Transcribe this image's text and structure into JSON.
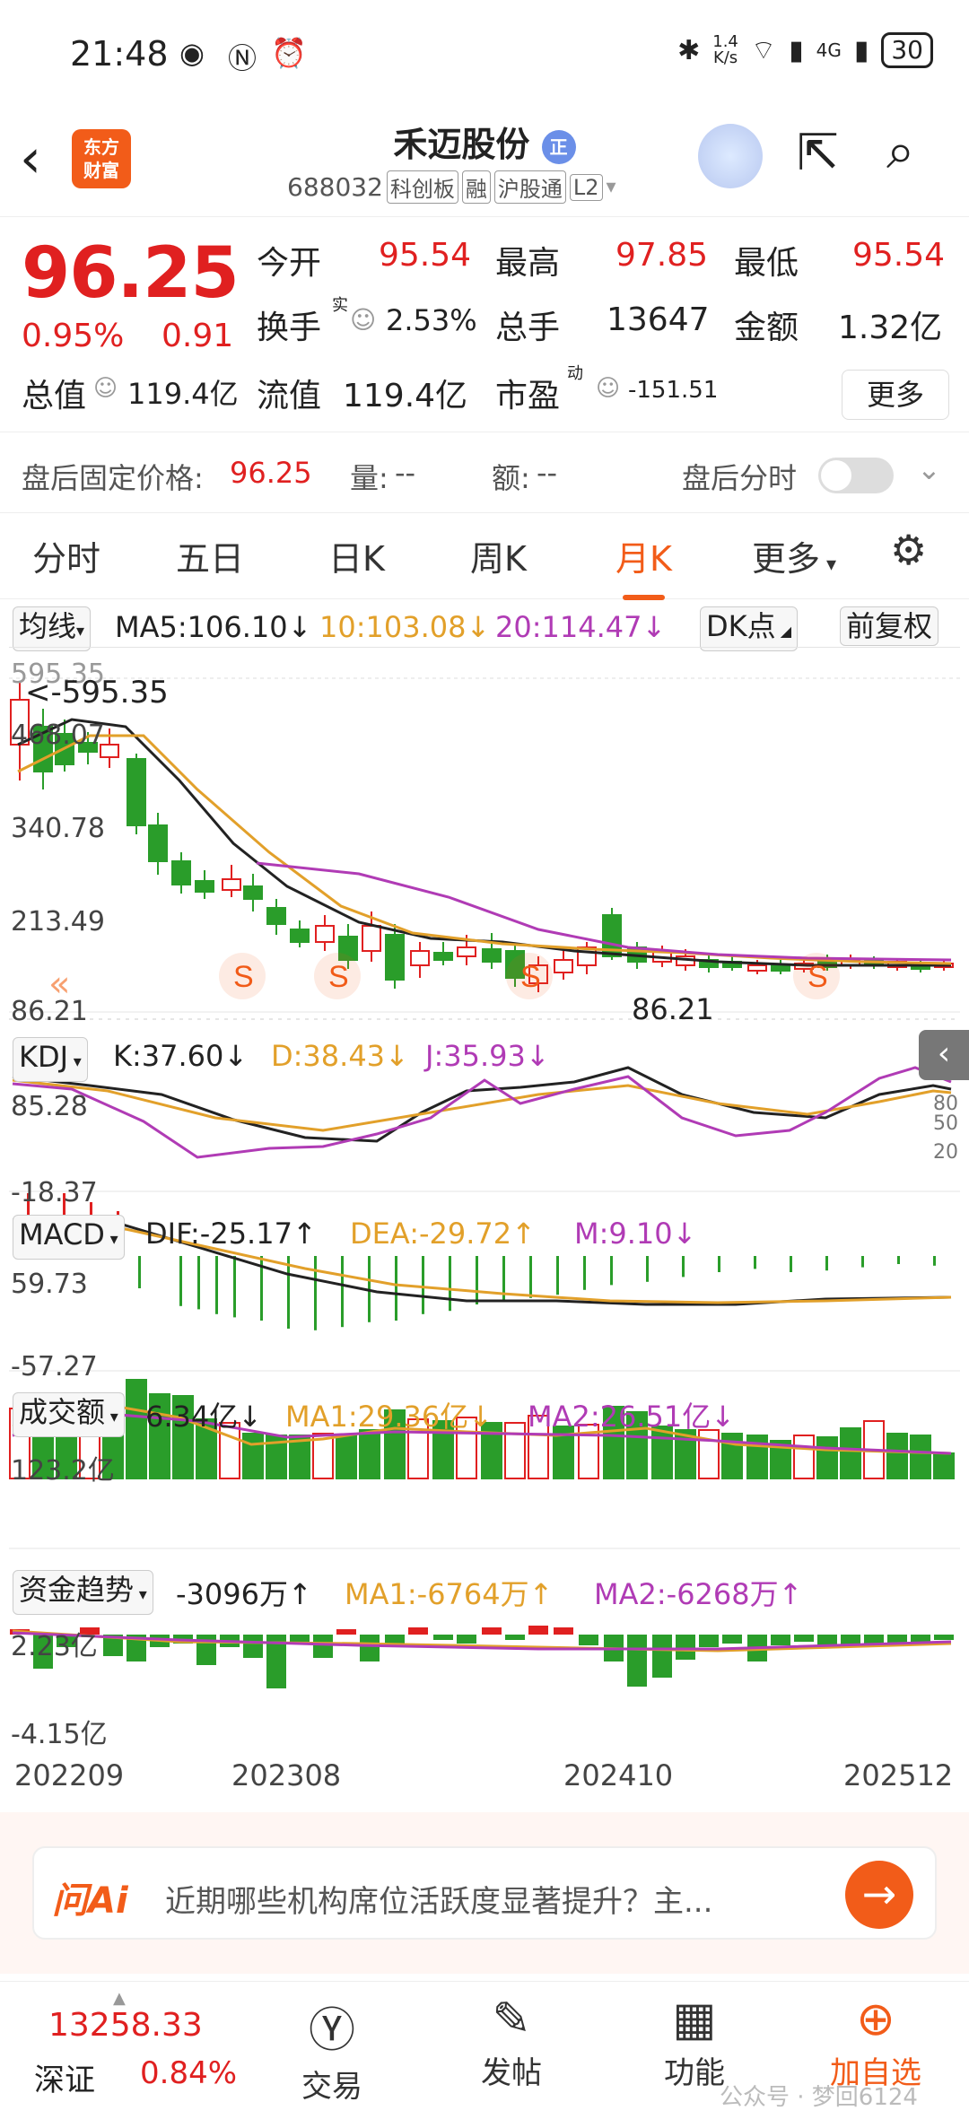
{
  "status_bar": {
    "time": "21:48",
    "net_speed": "1.4\nK/s",
    "network": "4G",
    "battery": "30"
  },
  "header": {
    "stock_name": "禾迈股份",
    "name_badge": "正",
    "logo": "东方\n财富",
    "code": "688032",
    "badges": [
      "科创板",
      "融",
      "沪股通",
      "L2"
    ]
  },
  "quote": {
    "price": "96.25",
    "change_pct": "0.95%",
    "change": "0.91",
    "open_label": "今开",
    "open": "95.54",
    "high_label": "最高",
    "high": "97.85",
    "low_label": "最低",
    "low": "95.54",
    "turnover_label": "换手",
    "turnover_sup": "实",
    "turnover": "2.53%",
    "volume_label": "总手",
    "volume": "13647",
    "amount_label": "金额",
    "amount": "1.32亿",
    "mcap_label": "总值",
    "mcap": "119.4亿",
    "float_label": "流值",
    "float": "119.4亿",
    "pe_label": "市盈",
    "pe_sup": "动",
    "pe": "-151.51",
    "more": "更多"
  },
  "after_hours": {
    "fixed_price_label": "盘后固定价格:",
    "fixed_price": "96.25",
    "volume_label": "量:",
    "volume": "--",
    "amount_label": "额:",
    "amount": "--",
    "intraday_label": "盘后分时"
  },
  "tabs": [
    "分时",
    "五日",
    "日K",
    "周K",
    "月K",
    "更多"
  ],
  "active_tab": "月K",
  "kline": {
    "ma_selector": "均线",
    "ma5": "MA5:106.10↓",
    "ma10": "10:103.08↓",
    "ma20": "20:114.47↓",
    "dk": "DK点",
    "adjust": "前复权",
    "y_labels": [
      "595.35",
      "468.07",
      "340.78",
      "213.49",
      "86.21"
    ],
    "max_marker": "<-595.35",
    "last_marker": "86.21",
    "signal": "S"
  },
  "kdj": {
    "selector": "KDJ",
    "k": "K:37.60↓",
    "d": "D:38.43↓",
    "j": "J:35.93↓",
    "y_top": "85.28",
    "y_bottom": "-18.37",
    "right_labels": [
      "80",
      "50",
      "20"
    ]
  },
  "macd": {
    "selector": "MACD",
    "dif": "DIF:-25.17↑",
    "dea": "DEA:-29.72↑",
    "m": "M:9.10↓",
    "y_top": "59.73",
    "y_bottom": "-57.27"
  },
  "volume": {
    "selector": "成交额",
    "value": "6.34亿↓",
    "ma1": "MA1:29.36亿↓",
    "ma2": "MA2:26.51亿↓",
    "y_top": "123.2亿"
  },
  "fund_flow": {
    "selector": "资金趋势",
    "value": "-3096万↑",
    "ma1": "MA1:-6764万↑",
    "ma2": "MA2:-6268万↑",
    "y_top": "2.23亿",
    "y_bottom": "-4.15亿"
  },
  "x_axis": [
    "202209",
    "202308",
    "202410",
    "202512"
  ],
  "ai": {
    "logo": "问Ai",
    "prompt": "近期哪些机构席位活跃度显著提升？主..."
  },
  "bottom_bar": {
    "index_value": "13258.33",
    "index_name": "深证",
    "index_change": "0.84%",
    "items": [
      "交易",
      "发帖",
      "功能",
      "加自选"
    ],
    "watermark": "公众号 · 梦回6124"
  },
  "colors": {
    "up": "#e02020",
    "down": "#2a9d2a",
    "accent": "#f25c19",
    "ma5": "#222222",
    "ma10": "#e2a02a",
    "ma20": "#b03bb5"
  }
}
